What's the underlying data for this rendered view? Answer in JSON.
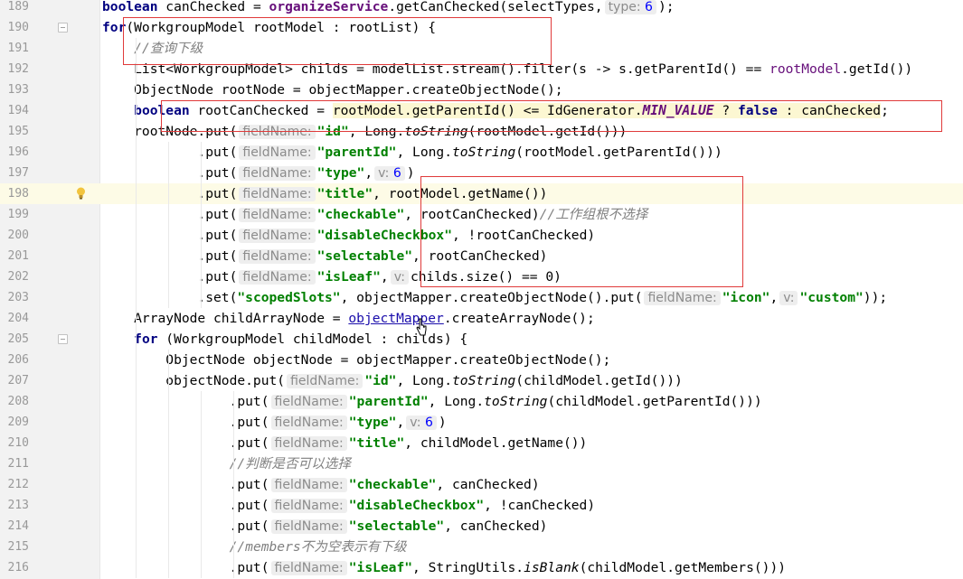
{
  "editor": {
    "language": "java",
    "caret_line": "198",
    "lines": [
      {
        "n": "189",
        "segs": [
          [
            "kw",
            "boolean"
          ],
          [
            "p",
            " canChecked = "
          ],
          [
            "svc",
            "organizeService"
          ],
          [
            "p",
            ".getCanChecked(selectTypes,"
          ],
          [
            "hint",
            "type:",
            "6"
          ],
          [
            "p",
            ");"
          ]
        ]
      },
      {
        "n": "190",
        "fold": true,
        "segs": [
          [
            "kw",
            "for"
          ],
          [
            "p",
            "(WorkgroupModel rootModel : rootList) {"
          ]
        ]
      },
      {
        "n": "191",
        "segs": [
          [
            "p",
            "    "
          ],
          [
            "cmt",
            "//查询下级"
          ]
        ]
      },
      {
        "n": "192",
        "segs": [
          [
            "p",
            "    List<WorkgroupModel> childs = modelList.stream().filter(s -> s.getParentId() == "
          ],
          [
            "fld",
            "rootModel"
          ],
          [
            "p",
            ".getId())"
          ]
        ]
      },
      {
        "n": "193",
        "segs": [
          [
            "p",
            "    ObjectNode rootNode = objectMapper.createObjectNode();"
          ]
        ]
      },
      {
        "n": "194",
        "segs": [
          [
            "p",
            "    "
          ],
          [
            "kw",
            "boolean"
          ],
          [
            "p",
            " rootCanChecked = "
          ],
          [
            "yel",
            "rootModel.getParentId() <= IdGenerator."
          ],
          [
            "cstY",
            "MIN_VALUE"
          ],
          [
            "yel",
            " ? "
          ],
          [
            "kwY",
            "false"
          ],
          [
            "yel",
            " : canChecked"
          ],
          [
            "p",
            ";"
          ]
        ]
      },
      {
        "n": "195",
        "segs": [
          [
            "p",
            "    rootNode.put("
          ],
          [
            "hint",
            "fieldName:",
            ""
          ],
          [
            "str",
            "\"id\""
          ],
          [
            "p",
            ", Long."
          ],
          [
            "fn",
            "toString"
          ],
          [
            "p",
            "(rootModel.getId()))"
          ]
        ]
      },
      {
        "n": "196",
        "segs": [
          [
            "p",
            "            .put("
          ],
          [
            "hint",
            "fieldName:",
            ""
          ],
          [
            "str",
            "\"parentId\""
          ],
          [
            "p",
            ", Long."
          ],
          [
            "fn",
            "toString"
          ],
          [
            "p",
            "(rootModel.getParentId()))"
          ]
        ]
      },
      {
        "n": "197",
        "segs": [
          [
            "p",
            "            .put("
          ],
          [
            "hint",
            "fieldName:",
            ""
          ],
          [
            "str",
            "\"type\""
          ],
          [
            "p",
            ","
          ],
          [
            "hint",
            "v:",
            "6"
          ],
          [
            "p",
            ")"
          ]
        ]
      },
      {
        "n": "198",
        "bulb": true,
        "segs": [
          [
            "p",
            "            .put("
          ],
          [
            "hint",
            "fieldName:",
            ""
          ],
          [
            "str",
            "\"title\""
          ],
          [
            "p",
            ", rootModel.getName())"
          ]
        ]
      },
      {
        "n": "199",
        "segs": [
          [
            "p",
            "            .put("
          ],
          [
            "hint",
            "fieldName:",
            ""
          ],
          [
            "str",
            "\"checkable\""
          ],
          [
            "p",
            ", rootCanChecked)"
          ],
          [
            "cmt",
            "//工作组根不选择"
          ]
        ]
      },
      {
        "n": "200",
        "segs": [
          [
            "p",
            "            .put("
          ],
          [
            "hint",
            "fieldName:",
            ""
          ],
          [
            "str",
            "\"disableCheckbox\""
          ],
          [
            "p",
            ", !rootCanChecked)"
          ]
        ]
      },
      {
        "n": "201",
        "segs": [
          [
            "p",
            "            .put("
          ],
          [
            "hint",
            "fieldName:",
            ""
          ],
          [
            "str",
            "\"selectable\""
          ],
          [
            "p",
            ", rootCanChecked)"
          ]
        ]
      },
      {
        "n": "202",
        "segs": [
          [
            "p",
            "            .put("
          ],
          [
            "hint",
            "fieldName:",
            ""
          ],
          [
            "str",
            "\"isLeaf\""
          ],
          [
            "p",
            ","
          ],
          [
            "hint",
            "v:",
            ""
          ],
          [
            "p",
            "childs.size() == 0)"
          ]
        ]
      },
      {
        "n": "203",
        "segs": [
          [
            "p",
            "            .set("
          ],
          [
            "str",
            "\"scopedSlots\""
          ],
          [
            "p",
            ", objectMapper.createObjectNode().put("
          ],
          [
            "hint",
            "fieldName:",
            ""
          ],
          [
            "str",
            "\"icon\""
          ],
          [
            "p",
            ","
          ],
          [
            "hint",
            "v:",
            ""
          ],
          [
            "str",
            "\"custom\""
          ],
          [
            "p",
            "));"
          ]
        ]
      },
      {
        "n": "204",
        "segs": [
          [
            "p",
            "    ArrayNode childArrayNode = "
          ],
          [
            "link",
            "objectMapper"
          ],
          [
            "p",
            ".createArrayNode();"
          ]
        ]
      },
      {
        "n": "205",
        "fold": true,
        "segs": [
          [
            "p",
            "    "
          ],
          [
            "kw",
            "for"
          ],
          [
            "p",
            " (WorkgroupModel childModel : childs) {"
          ]
        ]
      },
      {
        "n": "206",
        "segs": [
          [
            "p",
            "        ObjectNode objectNode = objectMapper.createObjectNode();"
          ]
        ]
      },
      {
        "n": "207",
        "segs": [
          [
            "p",
            "        objectNode.put("
          ],
          [
            "hint",
            "fieldName:",
            ""
          ],
          [
            "str",
            "\"id\""
          ],
          [
            "p",
            ", Long."
          ],
          [
            "fn",
            "toString"
          ],
          [
            "p",
            "(childModel.getId()))"
          ]
        ]
      },
      {
        "n": "208",
        "segs": [
          [
            "p",
            "                .put("
          ],
          [
            "hint",
            "fieldName:",
            ""
          ],
          [
            "str",
            "\"parentId\""
          ],
          [
            "p",
            ", Long."
          ],
          [
            "fn",
            "toString"
          ],
          [
            "p",
            "(childModel.getParentId()))"
          ]
        ]
      },
      {
        "n": "209",
        "segs": [
          [
            "p",
            "                .put("
          ],
          [
            "hint",
            "fieldName:",
            ""
          ],
          [
            "str",
            "\"type\""
          ],
          [
            "p",
            ","
          ],
          [
            "hint",
            "v:",
            "6"
          ],
          [
            "p",
            ")"
          ]
        ]
      },
      {
        "n": "210",
        "segs": [
          [
            "p",
            "                .put("
          ],
          [
            "hint",
            "fieldName:",
            ""
          ],
          [
            "str",
            "\"title\""
          ],
          [
            "p",
            ", childModel.getName())"
          ]
        ]
      },
      {
        "n": "211",
        "segs": [
          [
            "p",
            "                "
          ],
          [
            "cmt",
            "//判断是否可以选择"
          ]
        ]
      },
      {
        "n": "212",
        "segs": [
          [
            "p",
            "                .put("
          ],
          [
            "hint",
            "fieldName:",
            ""
          ],
          [
            "str",
            "\"checkable\""
          ],
          [
            "p",
            ", canChecked)"
          ]
        ]
      },
      {
        "n": "213",
        "segs": [
          [
            "p",
            "                .put("
          ],
          [
            "hint",
            "fieldName:",
            ""
          ],
          [
            "str",
            "\"disableCheckbox\""
          ],
          [
            "p",
            ", !canChecked)"
          ]
        ]
      },
      {
        "n": "214",
        "segs": [
          [
            "p",
            "                .put("
          ],
          [
            "hint",
            "fieldName:",
            ""
          ],
          [
            "str",
            "\"selectable\""
          ],
          [
            "p",
            ", canChecked)"
          ]
        ]
      },
      {
        "n": "215",
        "segs": [
          [
            "p",
            "                "
          ],
          [
            "cmt",
            "//members不为空表示有下级"
          ]
        ]
      },
      {
        "n": "216",
        "segs": [
          [
            "p",
            "                .put("
          ],
          [
            "hint",
            "fieldName:",
            ""
          ],
          [
            "str",
            "\"isLeaf\""
          ],
          [
            "p",
            ", StringUtils."
          ],
          [
            "fn",
            "isBlank"
          ],
          [
            "p",
            "(childModel.getMembers()))"
          ]
        ]
      }
    ]
  },
  "colors": {
    "annotation_box": "#e03a3a",
    "highlight": "#fcf7d2",
    "caret_line": "#fdfbe6"
  }
}
